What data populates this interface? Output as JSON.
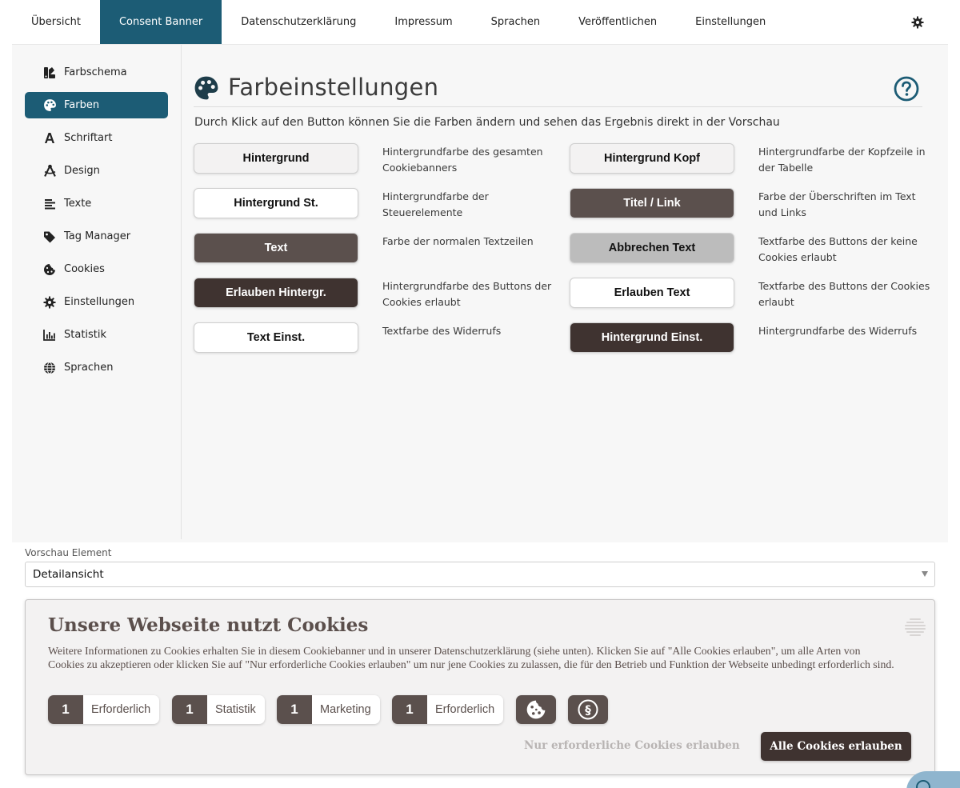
{
  "topnav": {
    "tabs": [
      {
        "label": "Übersicht"
      },
      {
        "label": "Consent Banner"
      },
      {
        "label": "Datenschutzerklärung"
      },
      {
        "label": "Impressum"
      },
      {
        "label": "Sprachen"
      },
      {
        "label": "Veröffentlichen"
      },
      {
        "label": "Einstellungen"
      }
    ],
    "active_tab": "Consent Banner",
    "settings_icon": "gear-icon"
  },
  "sidebar": {
    "items": [
      {
        "label": "Farbschema",
        "icon": "swatchbook-icon"
      },
      {
        "label": "Farben",
        "icon": "palette-icon"
      },
      {
        "label": "Schriftart",
        "icon": "font-icon"
      },
      {
        "label": "Design",
        "icon": "compass-drafting-icon"
      },
      {
        "label": "Texte",
        "icon": "align-left-icon"
      },
      {
        "label": "Tag Manager",
        "icon": "tag-icon"
      },
      {
        "label": "Cookies",
        "icon": "cookie-icon"
      },
      {
        "label": "Einstellungen",
        "icon": "gear-icon"
      },
      {
        "label": "Statistik",
        "icon": "chart-column-icon"
      },
      {
        "label": "Sprachen",
        "icon": "globe-icon"
      }
    ],
    "active_item": "Farben"
  },
  "main": {
    "title": "Farbeinstellungen",
    "intro": "Durch Klick auf den Button können Sie die Farben ändern und sehen das Ergebnis direkt in der Vorschau",
    "color_settings": [
      {
        "label": "Hintergrund",
        "description": "Hintergrundfarbe des gesamten Cookiebanners",
        "bg": "#f3f2f2",
        "fg": "#111111"
      },
      {
        "label": "Hintergrund Kopf",
        "description": "Hintergrundfarbe der Kopfzeile in der Tabelle",
        "bg": "#f3f2f2",
        "fg": "#111111"
      },
      {
        "label": "Hintergrund St.",
        "description": "Hintergrundfarbe der Steuerelemente",
        "bg": "#ffffff",
        "fg": "#111111"
      },
      {
        "label": "Titel / Link",
        "description": "Farbe der Überschriften im Text und Links",
        "bg": "#5b504d",
        "fg": "#ffffff"
      },
      {
        "label": "Text",
        "description": "Farbe der normalen Textzeilen",
        "bg": "#5b504d",
        "fg": "#ffffff"
      },
      {
        "label": "Abbrechen Text",
        "description": "Textfarbe des Buttons der keine Cookies erlaubt",
        "bg": "#bcbcbc",
        "fg": "#111111"
      },
      {
        "label": "Erlauben Hintergr.",
        "description": "Hintergrundfarbe des Buttons der Cookies erlaubt",
        "bg": "#3f3330",
        "fg": "#ffffff"
      },
      {
        "label": "Erlauben Text",
        "description": "Textfarbe des Buttons der Cookies erlaubt",
        "bg": "#ffffff",
        "fg": "#111111"
      },
      {
        "label": "Text Einst.",
        "description": "Textfarbe des Widerrufs",
        "bg": "#ffffff",
        "fg": "#111111"
      },
      {
        "label": "Hintergrund Einst.",
        "description": "Hintergrundfarbe des Widerrufs",
        "bg": "#3f3330",
        "fg": "#ffffff"
      }
    ]
  },
  "preview": {
    "label": "Vorschau Element",
    "selected": "Detailansicht"
  },
  "banner": {
    "title": "Unsere Webseite nutzt Cookies",
    "description": "Weitere Informationen zu Cookies erhalten Sie in diesem Cookiebanner und in unserer Datenschutzerklärung (siehe unten). Klicken Sie auf \"Alle Cookies erlauben\", um alle Arten von Cookies zu akzeptieren oder klicken Sie auf \"Nur erforderliche Cookies erlauben\" um nur jene Cookies zu zulassen, die für den Betrieb und Funktion der Webseite unbedingt erforderlich sind.",
    "categories": [
      {
        "count": "1",
        "label": "Erforderlich"
      },
      {
        "count": "1",
        "label": "Statistik"
      },
      {
        "count": "1",
        "label": "Marketing"
      },
      {
        "count": "1",
        "label": "Erforderlich"
      }
    ],
    "decline_label": "Nur erforderliche Cookies erlauben",
    "accept_label": "Alle Cookies erlauben",
    "colors": {
      "text": "#5b4f4c",
      "background": "#f3f2f2",
      "accept_bg": "#3f3330"
    }
  },
  "accent_color": "#1c5c75"
}
